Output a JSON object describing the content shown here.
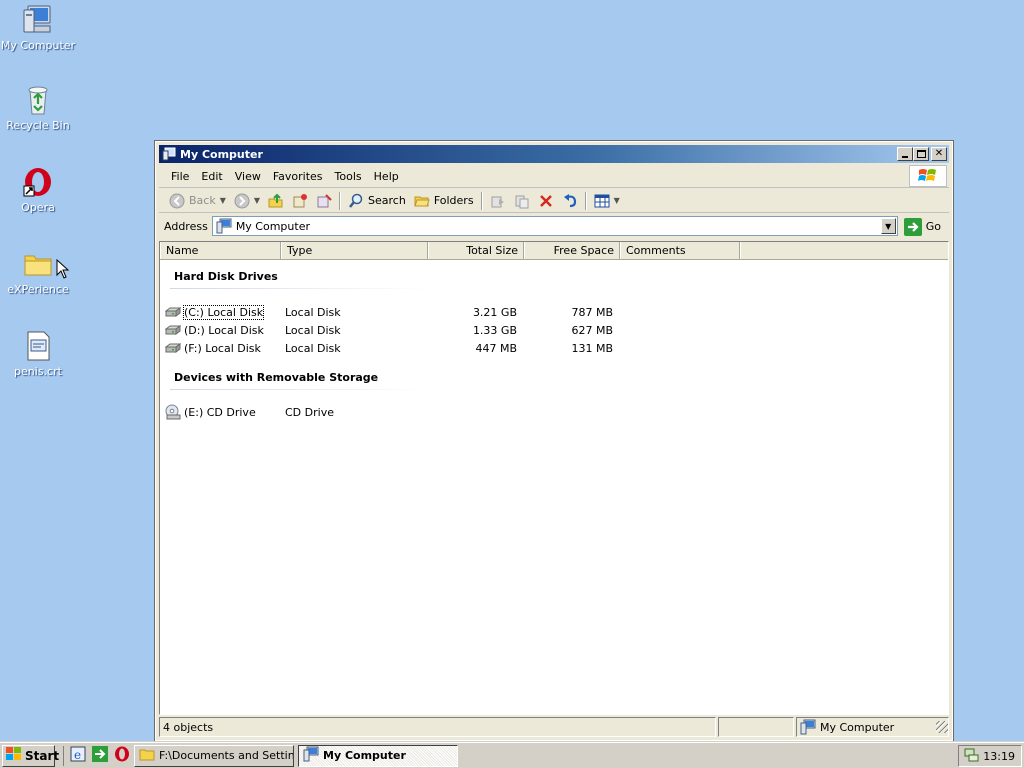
{
  "desktop": {
    "icons": [
      {
        "label": "My Computer",
        "icon": "my-computer-icon"
      },
      {
        "label": "Recycle Bin",
        "icon": "recycle-bin-icon"
      },
      {
        "label": "Opera",
        "icon": "opera-icon"
      },
      {
        "label": "eXPerience",
        "icon": "folder-icon"
      },
      {
        "label": "penis.crt",
        "icon": "certificate-file-icon"
      }
    ]
  },
  "window": {
    "title": "My Computer",
    "menu": [
      "File",
      "Edit",
      "View",
      "Favorites",
      "Tools",
      "Help"
    ],
    "toolbar": {
      "back": "Back",
      "search": "Search",
      "folders": "Folders"
    },
    "address": {
      "label": "Address",
      "value": "My Computer",
      "go": "Go"
    },
    "columns": [
      "Name",
      "Type",
      "Total Size",
      "Free Space",
      "Comments"
    ],
    "groups": [
      {
        "title": "Hard Disk Drives",
        "items": [
          {
            "name": "(C:) Local Disk",
            "type": "Local Disk",
            "total": "3.21 GB",
            "free": "787 MB"
          },
          {
            "name": "(D:) Local Disk",
            "type": "Local Disk",
            "total": "1.33 GB",
            "free": "627 MB"
          },
          {
            "name": "(F:) Local Disk",
            "type": "Local Disk",
            "total": "447 MB",
            "free": "131 MB"
          }
        ]
      },
      {
        "title": "Devices with Removable Storage",
        "items": [
          {
            "name": "(E:) CD Drive",
            "type": "CD Drive",
            "total": "",
            "free": ""
          }
        ]
      }
    ],
    "status": {
      "objects": "4 objects",
      "location": "My Computer"
    }
  },
  "taskbar": {
    "start": "Start",
    "tasks": [
      {
        "label": "F:\\Documents and Settin...",
        "active": false
      },
      {
        "label": "My Computer",
        "active": true
      }
    ],
    "clock": "13:19"
  },
  "colors": {
    "desktop": "#a5c9ef",
    "title_start": "#0a246a",
    "title_end": "#a6caf0",
    "face": "#ece9d8"
  }
}
